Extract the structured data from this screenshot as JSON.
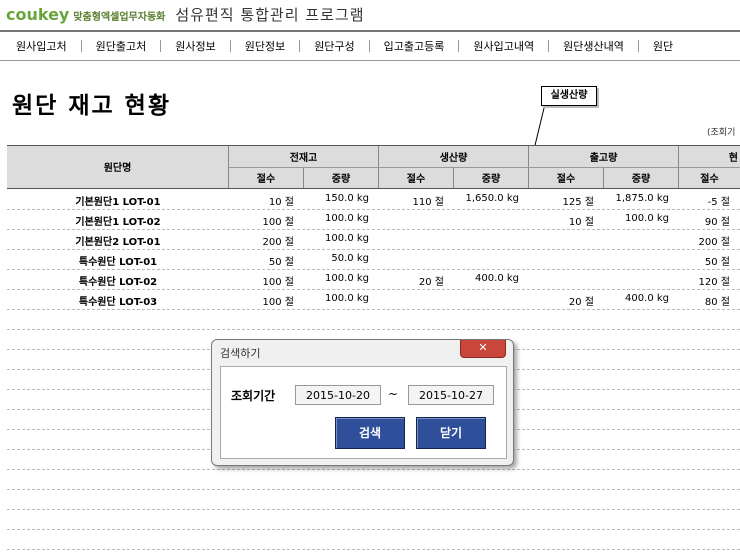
{
  "header": {
    "brand": "coukey",
    "tagline": "맞춤형엑셀업무자동화",
    "app_title": "섬유편직 통합관리 프로그램"
  },
  "nav": {
    "items": [
      "원사입고처",
      "원단출고처",
      "원사정보",
      "원단정보",
      "원단구성",
      "입고출고등록",
      "원사입고내역",
      "원단생산내역",
      "원단"
    ]
  },
  "page": {
    "title": "원단 재고 현황",
    "callout": "실생산량",
    "range_label": "(조회기"
  },
  "table": {
    "name_header": "원단명",
    "groups": [
      "전재고",
      "생산량",
      "출고량",
      "현"
    ],
    "sub_headers": [
      "절수",
      "중량",
      "절수",
      "중량",
      "절수",
      "중량",
      "절수"
    ],
    "rows": [
      {
        "name": "기본원단1 LOT-01",
        "prev_cnt": "10 절",
        "prev_wt": "150.0 kg",
        "prod_cnt": "110 절",
        "prod_wt": "1,650.0 kg",
        "out_cnt": "125 절",
        "out_wt": "1,875.0 kg",
        "cur_cnt": "-5 절"
      },
      {
        "name": "기본원단1 LOT-02",
        "prev_cnt": "100 절",
        "prev_wt": "100.0 kg",
        "prod_cnt": "",
        "prod_wt": "",
        "out_cnt": "10 절",
        "out_wt": "100.0 kg",
        "cur_cnt": "90 절"
      },
      {
        "name": "기본원단2 LOT-01",
        "prev_cnt": "200 절",
        "prev_wt": "100.0 kg",
        "prod_cnt": "",
        "prod_wt": "",
        "out_cnt": "",
        "out_wt": "",
        "cur_cnt": "200 절"
      },
      {
        "name": "특수원단 LOT-01",
        "prev_cnt": "50 절",
        "prev_wt": "50.0 kg",
        "prod_cnt": "",
        "prod_wt": "",
        "out_cnt": "",
        "out_wt": "",
        "cur_cnt": "50 절"
      },
      {
        "name": "특수원단 LOT-02",
        "prev_cnt": "100 절",
        "prev_wt": "100.0 kg",
        "prod_cnt": "20 절",
        "prod_wt": "400.0 kg",
        "out_cnt": "",
        "out_wt": "",
        "cur_cnt": "120 절"
      },
      {
        "name": "특수원단 LOT-03",
        "prev_cnt": "100 절",
        "prev_wt": "100.0 kg",
        "prod_cnt": "",
        "prod_wt": "",
        "out_cnt": "20 절",
        "out_wt": "400.0 kg",
        "cur_cnt": "80 절"
      }
    ]
  },
  "dialog": {
    "title": "검색하기",
    "close": "✕",
    "period_label": "조회기간",
    "start_date": "2015-10-20",
    "tilde": "~",
    "end_date": "2015-10-27",
    "search_button": "검색",
    "close_button": "닫기"
  },
  "colors": {
    "brand": "#6aa53b",
    "header_bg": "#dcdcdc",
    "button": "#2f4f9a",
    "close_button": "#c8463a",
    "marker": "#e03030"
  }
}
